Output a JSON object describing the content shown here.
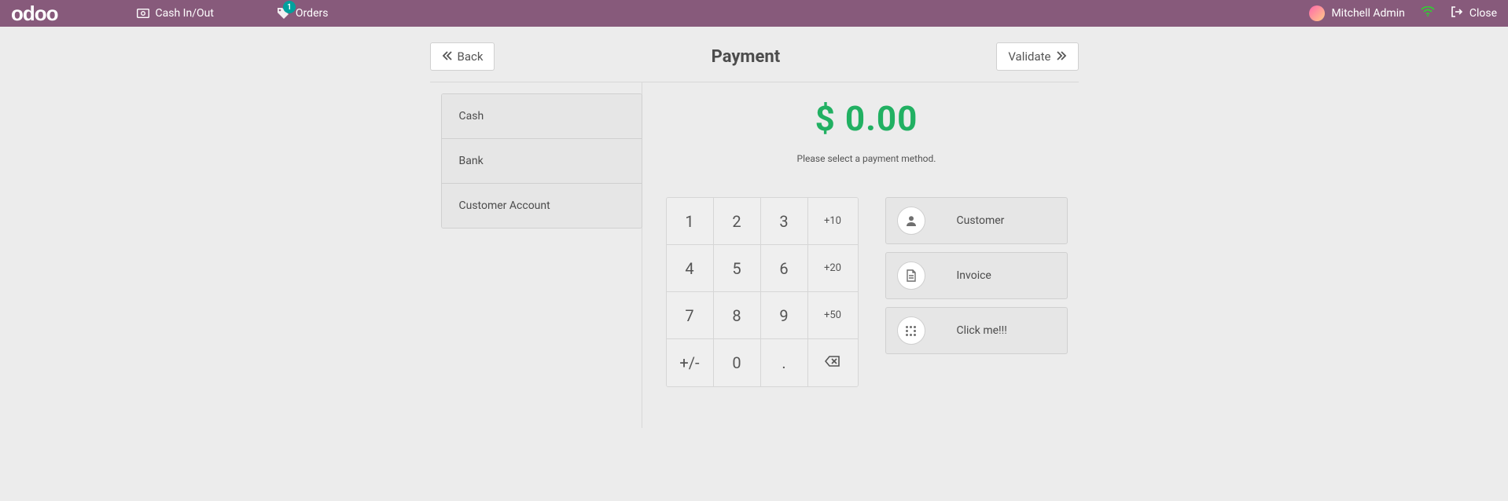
{
  "topbar": {
    "logo": "odoo",
    "cash_label": "Cash In/Out",
    "orders_label": "Orders",
    "orders_badge": "1",
    "user": "Mitchell Admin",
    "close_label": "Close"
  },
  "header": {
    "back_label": "Back",
    "title": "Payment",
    "validate_label": "Validate"
  },
  "methods": [
    {
      "label": "Cash"
    },
    {
      "label": "Bank"
    },
    {
      "label": "Customer Account"
    }
  ],
  "summary": {
    "amount": "$ 0.00",
    "prompt": "Please select a payment method."
  },
  "numpad": {
    "k1": "1",
    "k2": "2",
    "k3": "3",
    "p10": "+10",
    "k4": "4",
    "k5": "5",
    "k6": "6",
    "p20": "+20",
    "k7": "7",
    "k8": "8",
    "k9": "9",
    "p50": "+50",
    "sign": "+/-",
    "k0": "0",
    "dot": "."
  },
  "actions": {
    "customer": "Customer",
    "invoice": "Invoice",
    "clickme": "Click me!!!"
  }
}
